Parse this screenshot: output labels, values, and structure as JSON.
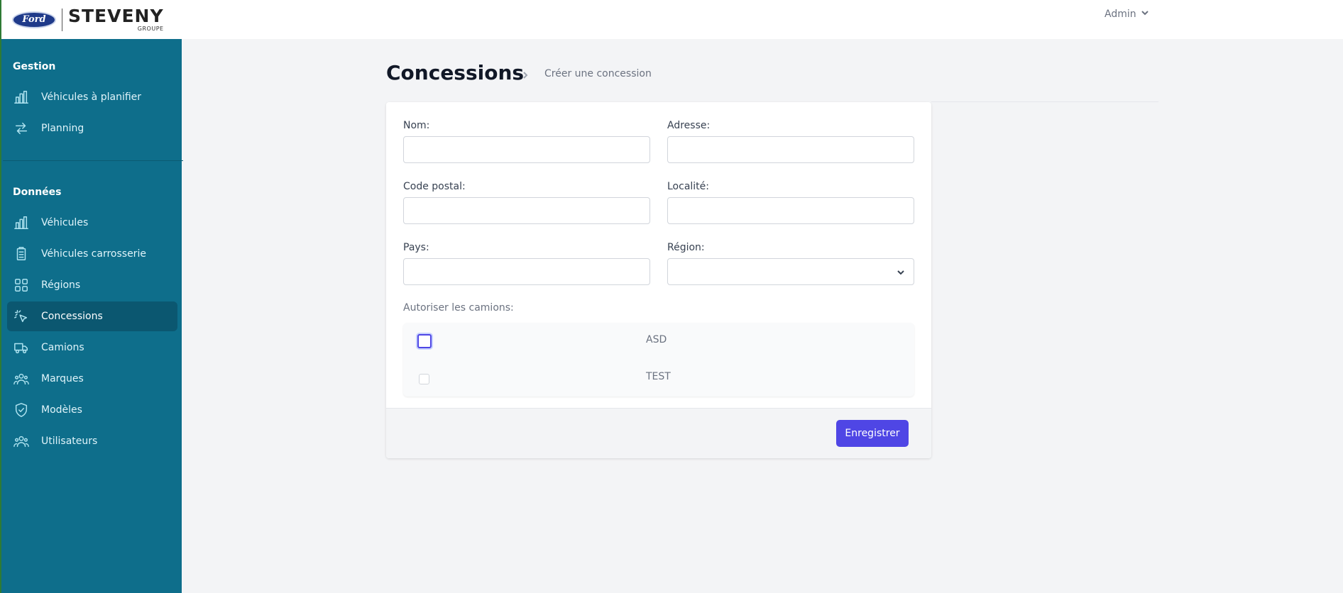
{
  "brand": {
    "ford_logo": "Ford",
    "name": "STEVENY",
    "subtitle": "GROUPE"
  },
  "user_menu": {
    "label": "Admin",
    "icon": "chevron-down-icon"
  },
  "sidebar": {
    "sections": [
      {
        "title": "Gestion",
        "items": [
          {
            "label": "Véhicules à planifier",
            "icon": "bar-chart-icon"
          },
          {
            "label": "Planning",
            "icon": "arrows-exchange-icon"
          }
        ]
      },
      {
        "title": "Données",
        "items": [
          {
            "label": "Véhicules",
            "icon": "bar-chart-icon"
          },
          {
            "label": "Véhicules carrosserie",
            "icon": "clipboard-icon"
          },
          {
            "label": "Régions",
            "icon": "grid-icon"
          },
          {
            "label": "Concessions",
            "icon": "cursor-click-icon",
            "active": true
          },
          {
            "label": "Camions",
            "icon": "truck-icon"
          },
          {
            "label": "Marques",
            "icon": "users-group-icon"
          },
          {
            "label": "Modèles",
            "icon": "shield-check-icon"
          },
          {
            "label": "Utilisateurs",
            "icon": "users-group-icon"
          }
        ]
      }
    ]
  },
  "header": {
    "title": "Concessions",
    "breadcrumb_current": "Créer une concession"
  },
  "form": {
    "nom": {
      "label": "Nom:",
      "value": ""
    },
    "adresse": {
      "label": "Adresse:",
      "value": ""
    },
    "code_postal": {
      "label": "Code postal:",
      "value": ""
    },
    "localite": {
      "label": "Localité:",
      "value": ""
    },
    "pays": {
      "label": "Pays:",
      "value": ""
    },
    "region": {
      "label": "Région:",
      "value": ""
    },
    "trucks_label": "Autoriser les camions:",
    "trucks": [
      {
        "name": "ASD",
        "checked": false,
        "focused": true
      },
      {
        "name": "TEST",
        "checked": false,
        "focused": false
      }
    ],
    "save_label": "Enregistrer"
  },
  "colors": {
    "sidebar_bg": "#0e6e8b",
    "sidebar_active": "#0b5770",
    "primary_button": "#4f46e5",
    "page_bg": "#f3f4f6"
  }
}
